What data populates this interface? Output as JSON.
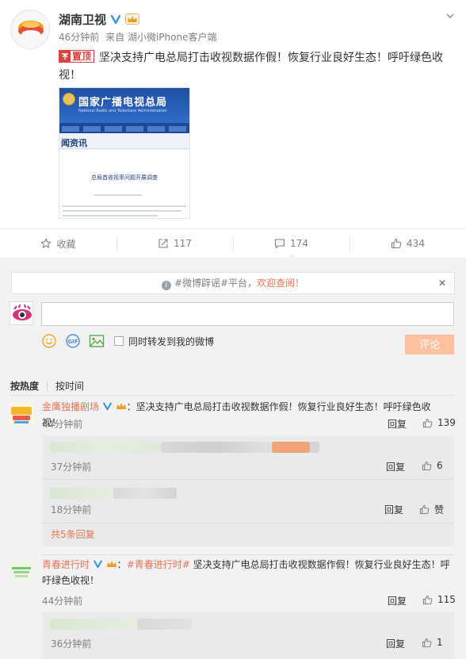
{
  "post": {
    "author": "湖南卫视",
    "time": "46分钟前",
    "source_prefix": "来自",
    "source": "湖小微iPhone客户端",
    "pin_label": "置顶",
    "text": "坚决支持广电总局打击收视数据作假！恢复行业良好生态！呼吁绿色收视！",
    "image": {
      "banner_title": "国家广播电视总局",
      "banner_sub": "National Radio and Television Administration",
      "section": "闻资讯",
      "article_title": "总局首收视率问题开展调查"
    }
  },
  "actions": [
    {
      "icon": "star-icon",
      "label": "收藏"
    },
    {
      "icon": "share-icon",
      "label": "117"
    },
    {
      "icon": "comment-icon",
      "label": "174"
    },
    {
      "icon": "thumbs-up-icon",
      "label": "434"
    }
  ],
  "notice": {
    "text": "#微博辟谣#平台，",
    "highlight": "欢迎查阅！"
  },
  "composer": {
    "forward_label": "同时转发到我的微博",
    "submit_label": "评论"
  },
  "sort": {
    "hot": "按热度",
    "time": "按时间"
  },
  "comments": [
    {
      "user": "金鹰独播剧场",
      "text": "：坚决支持广电总局打击收视数据作假！恢复行业良好生态！呼吁绿色收视！",
      "time": "44分钟前",
      "reply": "回复",
      "likes": "139",
      "sub_replies": [
        {
          "time": "37分钟前",
          "reply": "回复",
          "likes": "6"
        },
        {
          "time": "18分钟前",
          "reply": "回复",
          "likes": "赞"
        }
      ],
      "more": "共5条回复"
    },
    {
      "user": "青春进行时",
      "topic": "#青春进行时#",
      "text": " 坚决支持广电总局打击收视数据作假！恢复行业良好生态！呼吁绿色收视！",
      "time": "44分钟前",
      "reply": "回复",
      "likes": "115",
      "sub_replies": [
        {
          "time": "36分钟前",
          "reply": "回复",
          "likes": "1"
        }
      ]
    }
  ],
  "colors": {
    "accent": "#eb7350",
    "link_orange": "#eb7350",
    "pin_red": "#e0413f",
    "panel_bg": "#f2f2f5",
    "submit_bg": "#ffc09f"
  }
}
